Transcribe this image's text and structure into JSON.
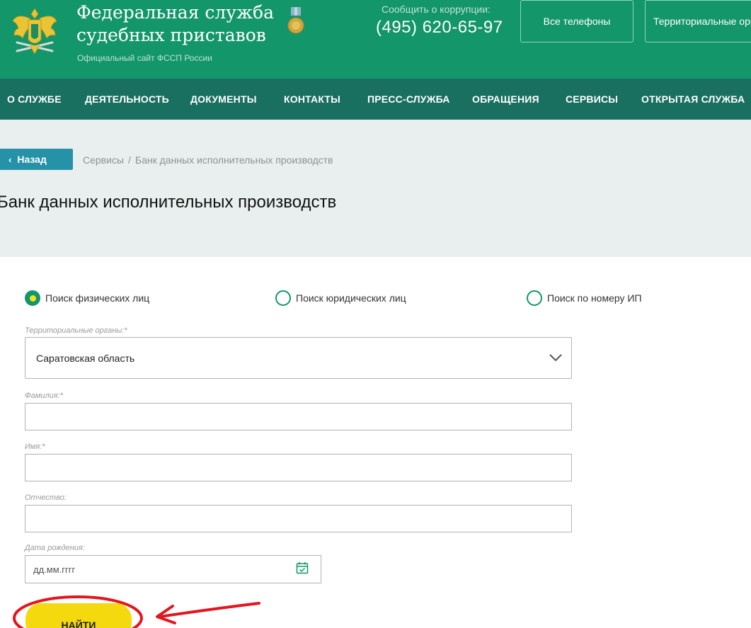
{
  "header": {
    "title": "Федеральная служба судебных приставов",
    "subtitle": "Официальный сайт ФССП России",
    "corruption_label": "Сообщить о коррупции:",
    "corruption_phone": "(495) 620-65-97",
    "buttons": [
      "Все телефоны",
      "Территориальные органы"
    ]
  },
  "nav": {
    "items": [
      "О СЛУЖБЕ",
      "ДЕЯТЕЛЬНОСТЬ",
      "ДОКУМЕНТЫ",
      "КОНТАКТЫ",
      "ПРЕСС-СЛУЖБА",
      "ОБРАЩЕНИЯ",
      "СЕРВИСЫ",
      "ОТКРЫТАЯ СЛУЖБА"
    ]
  },
  "page": {
    "back_label": "Назад",
    "breadcrumb": [
      "Сервисы",
      "Банк данных исполнительных производств"
    ],
    "breadcrumb_separator": "/",
    "title": "Банк данных исполнительных производств"
  },
  "form": {
    "search_modes": [
      {
        "label": "Поиск физических лиц",
        "selected": true
      },
      {
        "label": "Поиск юридических лиц",
        "selected": false
      },
      {
        "label": "Поиск по номеру ИП",
        "selected": false
      }
    ],
    "region_label": "Территориальные органы:*",
    "region_value": "Саратовская область",
    "lastname_label": "Фамилия:*",
    "lastname_value": "",
    "firstname_label": "Имя:*",
    "firstname_value": "",
    "patronymic_label": "Отчество:",
    "patronymic_value": "",
    "birthdate_label": "Дата рождения:",
    "birthdate_placeholder": "дд.мм.гггг",
    "submit_label": "НАЙТИ"
  },
  "colors": {
    "header_green": "#13966a",
    "nav_green": "#1a7060",
    "back_button": "#2592a8",
    "submit_yellow": "#f5d90f",
    "annotation_red": "#e3161f"
  },
  "icons": [
    "coat-of-arms-emblem",
    "medal-icon",
    "chevron-left-icon",
    "chevron-down-icon",
    "calendar-icon"
  ]
}
